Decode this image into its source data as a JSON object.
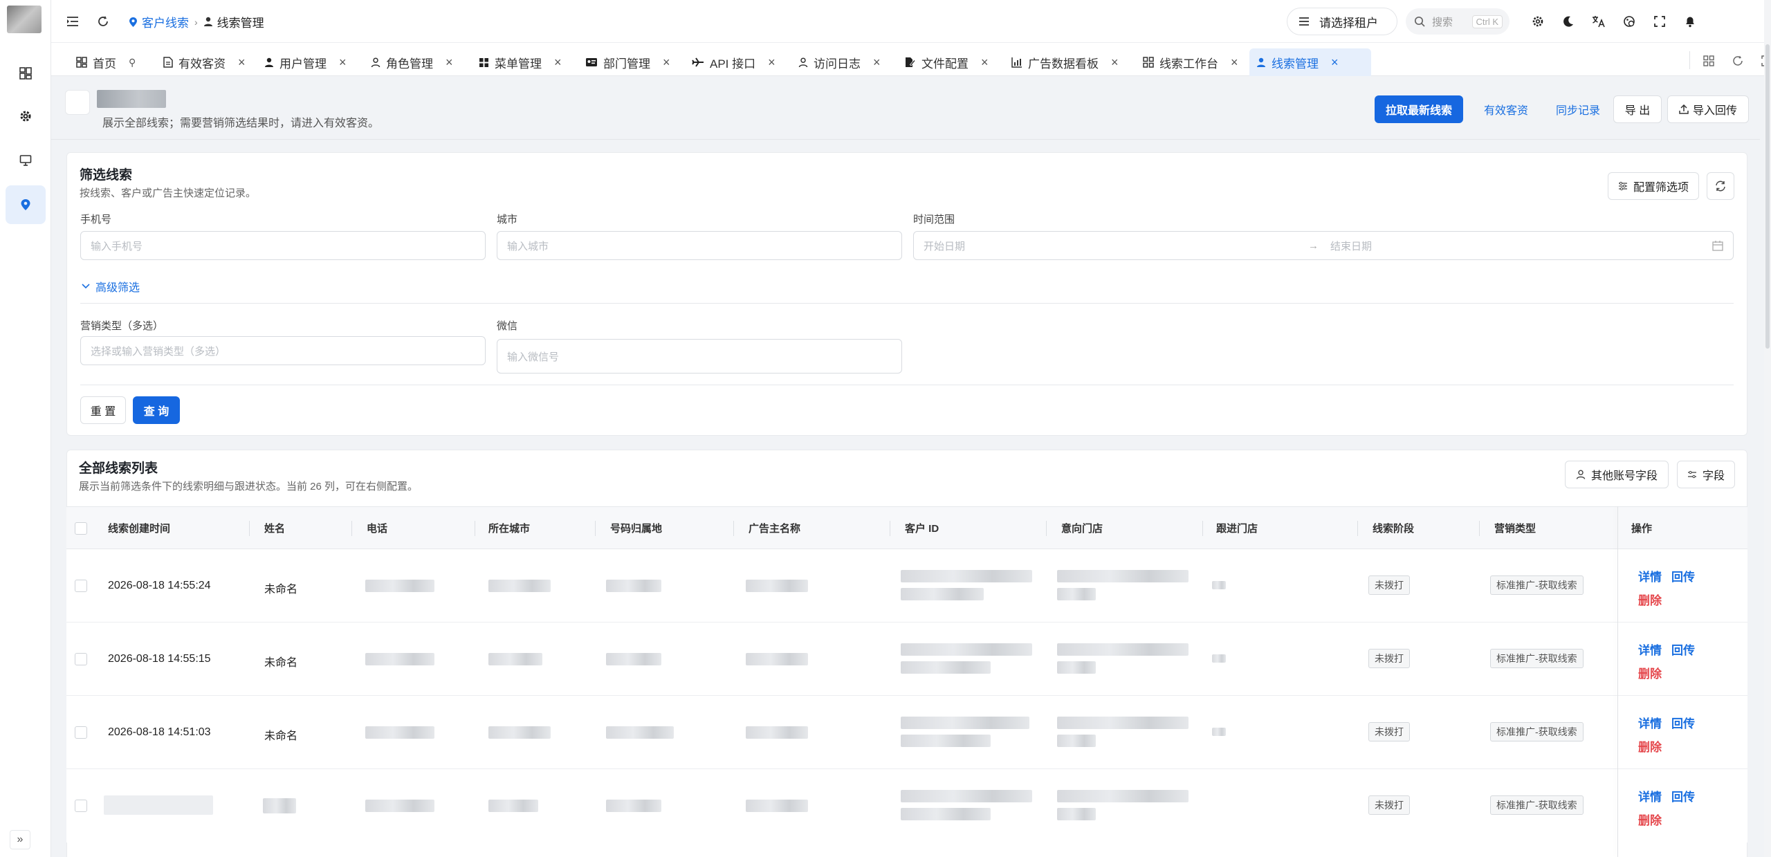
{
  "breadcrumb": {
    "parent": "客户线索",
    "current": "线索管理"
  },
  "header": {
    "tenant_label": "请选择租户",
    "search_placeholder": "搜索",
    "search_shortcut": "Ctrl K"
  },
  "tabs": [
    {
      "label": "首页"
    },
    {
      "label": "有效客资"
    },
    {
      "label": "用户管理"
    },
    {
      "label": "角色管理"
    },
    {
      "label": "菜单管理"
    },
    {
      "label": "部门管理"
    },
    {
      "label": "API 接口"
    },
    {
      "label": "访问日志"
    },
    {
      "label": "文件配置"
    },
    {
      "label": "广告数据看板"
    },
    {
      "label": "线索工作台"
    },
    {
      "label": "线索管理"
    }
  ],
  "page": {
    "description": "展示全部线索；需要营销筛选结果时，请进入有效客资。",
    "actions": {
      "pull": "拉取最新线索",
      "valid": "有效客资",
      "sync": "同步记录",
      "export": "导 出",
      "import": "导入回传"
    }
  },
  "filter": {
    "title": "筛选线索",
    "subtitle": "按线索、客户或广告主快速定位记录。",
    "config_label": "配置筛选项",
    "phone_label": "手机号",
    "phone_placeholder": "输入手机号",
    "city_label": "城市",
    "city_placeholder": "输入城市",
    "time_label": "时间范围",
    "start_placeholder": "开始日期",
    "end_placeholder": "结束日期",
    "advanced_label": "高级筛选",
    "marketing_label": "营销类型（多选）",
    "marketing_placeholder": "选择或输入营销类型（多选）",
    "wechat_label": "微信",
    "wechat_placeholder": "输入微信号",
    "reset_label": "重 置",
    "query_label": "查 询"
  },
  "list": {
    "title": "全部线索列表",
    "subtitle": "展示当前筛选条件下的线索明细与跟进状态。当前 26 列，可在右侧配置。",
    "other_fields_label": "其他账号字段",
    "fields_label": "字段",
    "columns": [
      "线索创建时间",
      "姓名",
      "电话",
      "所在城市",
      "号码归属地",
      "广告主名称",
      "客户 ID",
      "意向门店",
      "跟进门店",
      "线索阶段",
      "营销类型",
      "操作"
    ],
    "rows": [
      {
        "created": "2026-08-18 14:55:24",
        "name": "未命名",
        "stage": "未拨打",
        "marketing": "标准推广-获取线索"
      },
      {
        "created": "2026-08-18 14:55:15",
        "name": "未命名",
        "stage": "未拨打",
        "marketing": "标准推广-获取线索"
      },
      {
        "created": "2026-08-18 14:51:03",
        "name": "未命名",
        "stage": "未拨打",
        "marketing": "标准推广-获取线索"
      },
      {
        "created": "",
        "name": "",
        "stage": "未拨打",
        "marketing": "标准推广-获取线索"
      }
    ],
    "ops": {
      "detail": "详情",
      "callback": "回传",
      "delete": "删除"
    }
  },
  "colors": {
    "primary": "#1667e0",
    "danger": "#e5484d",
    "active_tab_bg": "#e6effc"
  }
}
